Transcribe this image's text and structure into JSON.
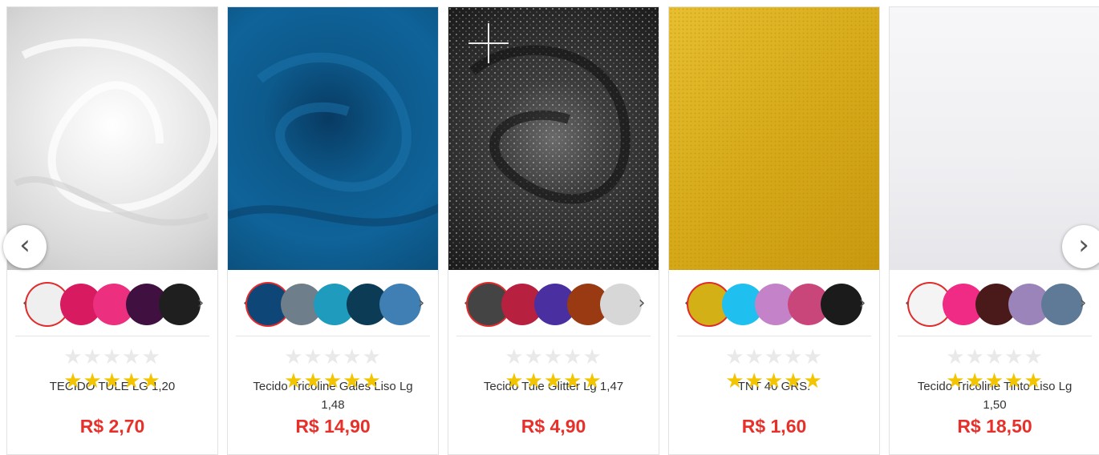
{
  "carousel": {
    "prev_icon": "chevron-left-icon",
    "next_icon": "chevron-right-icon",
    "prev_glyph": "‹",
    "next_glyph": "›",
    "swatch_prev_glyph": "‹",
    "swatch_next_glyph": "›",
    "star_glyphs": "★★★★★",
    "products": [
      {
        "name": "TECIDO TULE LG 1,20",
        "price": "R$ 2,70",
        "rating_stars": 5,
        "image_colors": [
          "#f4f4f4",
          "#d9d9d9"
        ],
        "swatches": [
          "#efefef",
          "#d81b60",
          "#ec2f7e",
          "#3f1040",
          "#1f1f1f"
        ]
      },
      {
        "name": "Tecido Tricoline Gales Liso Lg 1,48",
        "price": "R$ 14,90",
        "rating_stars": 5,
        "image_colors": [
          "#0d5a8c",
          "#0a3f66"
        ],
        "swatches": [
          "#0e4677",
          "#6e7e8a",
          "#1f9bbd",
          "#0b3b55",
          "#3f7fb4"
        ]
      },
      {
        "name": "Tecido Tule Glitter Lg 1,47",
        "price": "R$ 4,90",
        "rating_stars": 5,
        "image_colors": [
          "#5a5a5a",
          "#1b1b1b"
        ],
        "swatches": [
          "#444444",
          "#b8203f",
          "#4a2fa0",
          "#9a3a12",
          "#d7d7d7"
        ]
      },
      {
        "name": "TNT 40 GRS.",
        "price": "R$ 1,60",
        "rating_stars": 5,
        "image_colors": [
          "#e0b72a",
          "#c99a10"
        ],
        "swatches": [
          "#d4b017",
          "#1fc0ef",
          "#c482c8",
          "#c9467a",
          "#1b1b1b"
        ]
      },
      {
        "name": "Tecido Tricoline Tinto Liso Lg 1,50",
        "price": "R$ 18,50",
        "rating_stars": 5,
        "image_colors": [
          "#f4f4f6",
          "#e6e6ea"
        ],
        "swatches": [
          "#f4f4f4",
          "#f02b85",
          "#4a1a1a",
          "#9a84b9",
          "#5e7a96"
        ]
      }
    ]
  }
}
